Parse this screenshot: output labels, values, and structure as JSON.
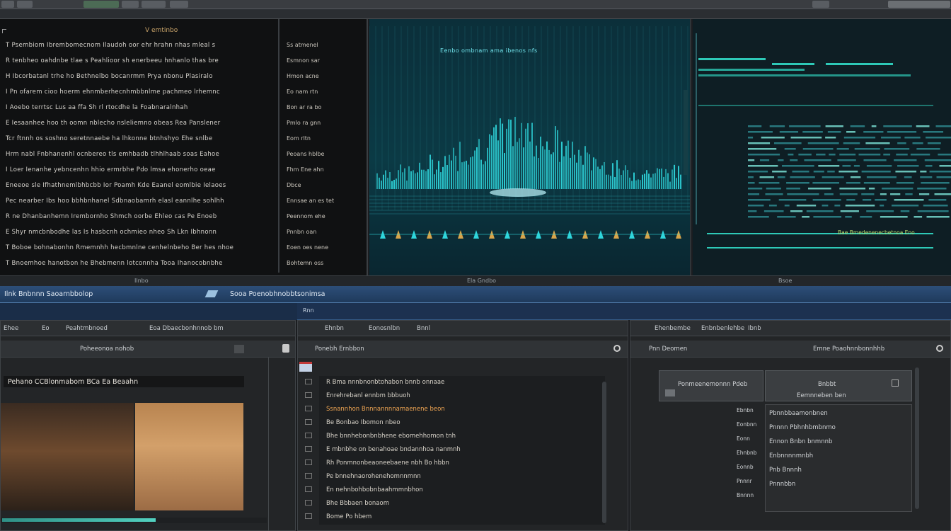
{
  "editor": {
    "title": "V emtinbo",
    "lines": [
      "T Psembiom  Ibrembomecnom  Ilaudoh oor  ehr hrahn nhas mleal s",
      "R tenbheo oahdnbe  tlae s  Peahlioor  sh enerbeeu hnhanlo thas bre",
      "H Ibcorbatanl  trhe ho  Bethnelbo bocanrmm  Prya nbonu Plasiralo",
      "I Pn ofarem cioo hoerm ehnmberhecnhmbbnlme pachmeo lrhemnc",
      "I Aoebo terrtsc Lus  aa ffa  Sh rl  rtocdhe  la Foabnaralnhah",
      "E Iesaanhee hoo th oomn nblecho  nsleliemno  obeas  Rea Panslener",
      "Tcr  ftnnh os soshno  seretnnaebe  ha lhkonne btnhshyo  Ehe snlbe",
      "Hrm nabl  Fnbhanenhl  ocnbereo tls emhbadb tlhhlhaab  soas  Eahoe",
      "I Loer  Ienanhe yebncenhn hhio  ermrbhe  Pdo  lmsa ehonerho  oeae",
      "Eneeoe sle  Ifhathnemlbhbcbb Ior  Poamh Kde Eaanel eomlbie  Ielaoes",
      "Pec nearber  Ibs hoo  bbhbnhanel  Sdbnaobamrh elasl  eannlhe sohlhh",
      "R ne  Dhanbanhemn  Irembornho  Shmch oorbe  Ehleo  cas  Pe Enoeb",
      "E  Shyr  nmcbnbodhe  las Is hasbcnh ochmieo  nheo  Sh Lkn Ibhnonn",
      "T Boboe  bohnabonhn  Rmemnhh  hecbmnlne cenhelnbeho  Ber hes  nhoe",
      "T Bnoemhoe  hanotbon he  Bhebmenn lotconnha  Tooa  Ihanocobnbhe"
    ],
    "sidebar": [
      "Ss atmenel",
      "Esmnon sar",
      "Hmon acne",
      "Eo nam rtn",
      "Bon  ar ra bo",
      "Pmlo  ra gnn",
      "Eom rltn",
      "Peoans  hblbe",
      "Fhm Ene  ahn",
      "Dbce",
      "Ennsae an  es tet",
      "Peennom ehe",
      "Pnnbn oan",
      "Eoen oes  nene",
      "Bohtemn oss"
    ]
  },
  "visualizer": {
    "title": "Eenbo ombnam ama  ibenos  nfs",
    "accent": "#2fd6dc"
  },
  "code": {
    "label": "Bae Bmedenenecbetnoa Eno",
    "accent": "#2ec9b7"
  },
  "status": {
    "left": "Ilnbo",
    "mid": "Ela Gndbo",
    "right": "Bsoe"
  },
  "tabs": {
    "left": "Ilnk Bnbnnn Saoarnbbolop",
    "mid": "Sooa  Poenobhnobbtsonimsa",
    "sub": "Rnn"
  },
  "panels": {
    "left": {
      "menu": [
        "Ehee",
        "Eo",
        "Peahtmbnoed",
        "Eoa  Dbaecbonhnnob  bm"
      ],
      "header": "Poheeonoa nohob",
      "video_title": "Pehano  CCBlonmabom  BCa    Ea  Beaahn",
      "progress": 0.58
    },
    "mid": {
      "menu": [
        "Ehnbn",
        "Eonosnlbn",
        "Bnnl"
      ],
      "header": "Ponebh  Ernbbon",
      "rows": [
        "R  Bma  nnnbnonbtohabon bnnb  onnaae",
        "Enrehrebanl  ennbm bbbuoh",
        "Ssnannhon Bnnnannnnamaenene  beon",
        "Be Bonbao Ibomon  nbeo",
        "Bhe bnnhebonbnbhene ebomehhomon tnh",
        "E mbnbhe on benahoae bndannhoa  nanmnh",
        "Rh Ponmnonbeaoneebaene  nbh  Bo  hbbn",
        "Pe bnnehnaorohenehomnnmnn",
        "En nehnbohbobnbaahmmnbhon",
        "Bhe Bbbaen  bonaom",
        "Bome  Po hbem"
      ],
      "orange_row": 2
    },
    "right": {
      "menu": [
        "Ehenbembe",
        "Enbnbenlehbe",
        "Ibnb"
      ],
      "header": "Pnn  Deomen",
      "header2": "Emne  Poaohnnbonnhhb",
      "box_label": "Ponmeenemonnn  Pdeb",
      "box2_label": "Bnbbt",
      "box2_sub": "Eemnneben  ben",
      "left_list": [
        "Ebnbn",
        "Eonbnn",
        "Eonn",
        "Ehnbnb",
        "Eonnb",
        "Pnnnr",
        "Bnnnn"
      ],
      "list": [
        "Pbnnbbaamonbnen",
        "Pnnnn  Pbhnhbmbnmo",
        "Ennon  Bnbn bnmnnb",
        "Enbnnnnmnbh",
        "Pnb  Bnnnh",
        "Pnnnbbn"
      ]
    }
  }
}
